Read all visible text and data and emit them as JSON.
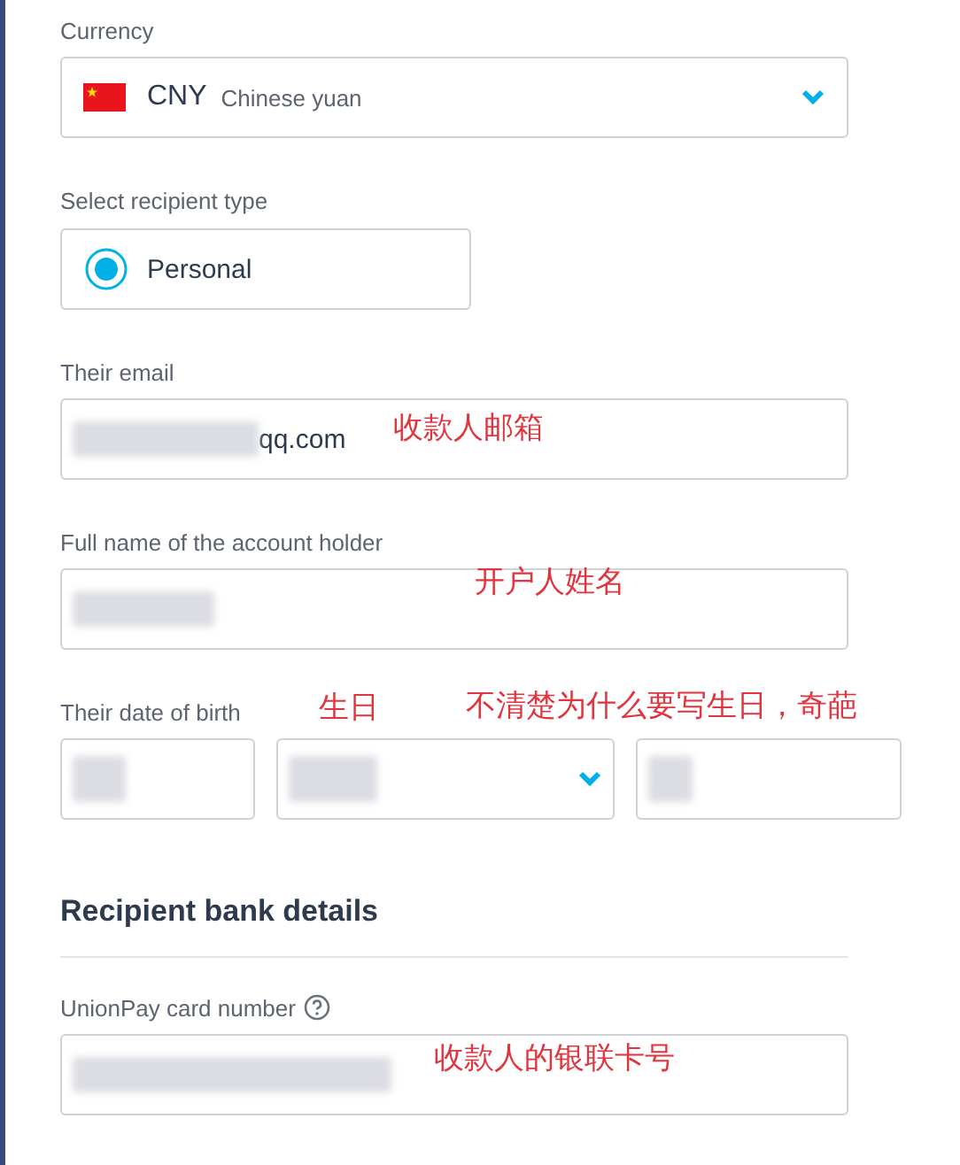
{
  "currency": {
    "label": "Currency",
    "code": "CNY",
    "name": "Chinese yuan"
  },
  "recipient_type": {
    "label": "Select recipient type",
    "options": [
      {
        "label": "Personal",
        "selected": true
      }
    ]
  },
  "email": {
    "label": "Their email",
    "value": "qq.com",
    "redacted": true,
    "annotation": "收款人邮箱"
  },
  "full_name": {
    "label": "Full name of the account holder",
    "redacted": true,
    "annotation": "开户人姓名"
  },
  "date_of_birth": {
    "label": "Their date of birth",
    "annotations": [
      "生日",
      "不清楚为什么要写生日，奇葩"
    ],
    "parts": [
      {
        "kind": "text",
        "redacted": true
      },
      {
        "kind": "select",
        "redacted": true
      },
      {
        "kind": "text",
        "redacted": true
      }
    ]
  },
  "bank_section": {
    "heading": "Recipient bank details"
  },
  "card_number": {
    "label": "UnionPay card number",
    "redacted": true,
    "annotation": "收款人的银联卡号"
  }
}
